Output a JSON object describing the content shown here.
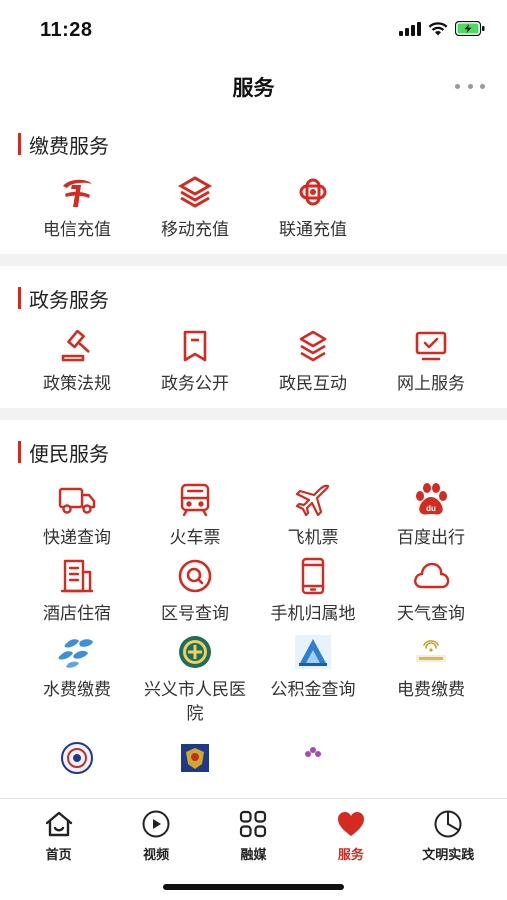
{
  "status": {
    "time": "11:28"
  },
  "header": {
    "title": "服务"
  },
  "colors": {
    "accent": "#d42a20",
    "divider": "#f2f2f2"
  },
  "sections": [
    {
      "title": "缴费服务",
      "items": [
        {
          "label": "电信充值",
          "icon": "telecom-logo-icon"
        },
        {
          "label": "移动充值",
          "icon": "china-mobile-logo-icon"
        },
        {
          "label": "联通充值",
          "icon": "china-unicom-logo-icon"
        }
      ]
    },
    {
      "title": "政务服务",
      "items": [
        {
          "label": "政策法规",
          "icon": "gavel-icon"
        },
        {
          "label": "政务公开",
          "icon": "bookmark-icon"
        },
        {
          "label": "政民互动",
          "icon": "layers-icon"
        },
        {
          "label": "网上服务",
          "icon": "monitor-check-icon"
        }
      ]
    },
    {
      "title": "便民服务",
      "items": [
        {
          "label": "快递查询",
          "icon": "delivery-truck-icon"
        },
        {
          "label": "火车票",
          "icon": "train-icon"
        },
        {
          "label": "飞机票",
          "icon": "airplane-icon"
        },
        {
          "label": "百度出行",
          "icon": "baidu-paw-icon"
        },
        {
          "label": "酒店住宿",
          "icon": "hotel-building-icon"
        },
        {
          "label": "区号查询",
          "icon": "search-circle-icon"
        },
        {
          "label": "手机归属地",
          "icon": "mobile-phone-icon"
        },
        {
          "label": "天气查询",
          "icon": "cloud-icon"
        },
        {
          "label": "水费缴费",
          "icon": "water-drops-icon"
        },
        {
          "label": "兴义市人民医院",
          "icon": "hospital-emblem-icon"
        },
        {
          "label": "公积金查询",
          "icon": "housing-fund-logo-icon"
        },
        {
          "label": "电费缴费",
          "icon": "power-company-logo-icon"
        }
      ]
    }
  ],
  "tabbar": {
    "items": [
      {
        "label": "首页",
        "icon": "home-icon"
      },
      {
        "label": "视频",
        "icon": "play-circle-icon"
      },
      {
        "label": "融媒",
        "icon": "grid-four-icon"
      },
      {
        "label": "服务",
        "icon": "heart-icon",
        "active": true
      },
      {
        "label": "文明实践",
        "icon": "pie-chart-icon"
      }
    ]
  }
}
